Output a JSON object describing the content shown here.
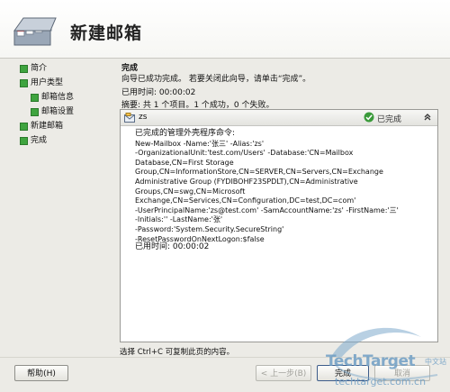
{
  "header": {
    "title": "新建邮箱"
  },
  "nav": {
    "items": [
      {
        "label": "简介",
        "level": 0
      },
      {
        "label": "用户类型",
        "level": 0
      },
      {
        "label": "邮箱信息",
        "level": 1
      },
      {
        "label": "邮箱设置",
        "level": 1
      },
      {
        "label": "新建邮箱",
        "level": 0
      },
      {
        "label": "完成",
        "level": 0
      }
    ]
  },
  "content": {
    "heading": "完成",
    "description": "向导已成功完成。 若要关闭此向导，请单击“完成”。",
    "elapsed": "已用时间: 00:00:02",
    "summary": "摘要: 共 1 个项目。1 个成功，0 个失败。"
  },
  "result": {
    "name": "zs",
    "status": "已完成",
    "command_title": "已完成的管理外壳程序命令:",
    "command_lines": [
      "New-Mailbox -Name:'张三' -Alias:'zs'",
      "-OrganizationalUnit:'test.com/Users' -Database:'CN=Mailbox",
      "Database,CN=First Storage",
      "Group,CN=InformationStore,CN=SERVER,CN=Servers,CN=Exchange",
      "Administrative Group (FYDIBOHF23SPDLT),CN=Administrative",
      "Groups,CN=swg,CN=Microsoft",
      "Exchange,CN=Services,CN=Configuration,DC=test,DC=com'",
      "-UserPrincipalName:'zs@test.com' -SamAccountName:'zs' -FirstName:'三'",
      "-Initials:'' -LastName:'张'",
      "-Password:'System.Security.SecureString'",
      "-ResetPasswordOnNextLogon:$false"
    ],
    "elapsed": "已用时间: 00:00:02"
  },
  "hint": "选择 Ctrl+C 可复制此页的内容。",
  "buttons": {
    "help": "帮助(H)",
    "back": "< 上一步(B)",
    "finish": "完成",
    "cancel": "取消"
  },
  "watermark": {
    "brand": "TechTarget",
    "suffix": "中文站",
    "url": "techtarget.com.cn"
  },
  "colors": {
    "nav_marker": "#3fa43f",
    "status_check": "#3a9a3a",
    "watermark": "#6f9ec4"
  }
}
